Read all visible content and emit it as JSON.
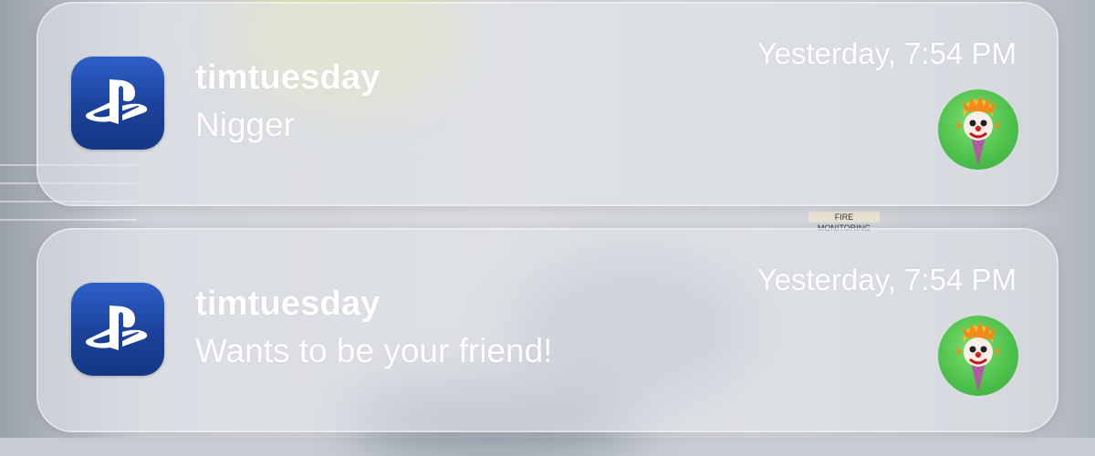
{
  "notifications": [
    {
      "app_icon": "playstation-icon",
      "sender": "timtuesday",
      "message": "Nigger",
      "timestamp": "Yesterday, 7:54 PM",
      "avatar": "clown-avatar"
    },
    {
      "app_icon": "playstation-icon",
      "sender": "timtuesday",
      "message": "Wants to be your friend!",
      "timestamp": "Yesterday, 7:54 PM",
      "avatar": "clown-avatar"
    }
  ],
  "background": {
    "sign_text": "FIRE MONITORING"
  },
  "colors": {
    "app_icon_blue": "#1b4299",
    "avatar_green": "#4cbf4b",
    "card_background": "rgba(225,228,233,0.62)"
  }
}
